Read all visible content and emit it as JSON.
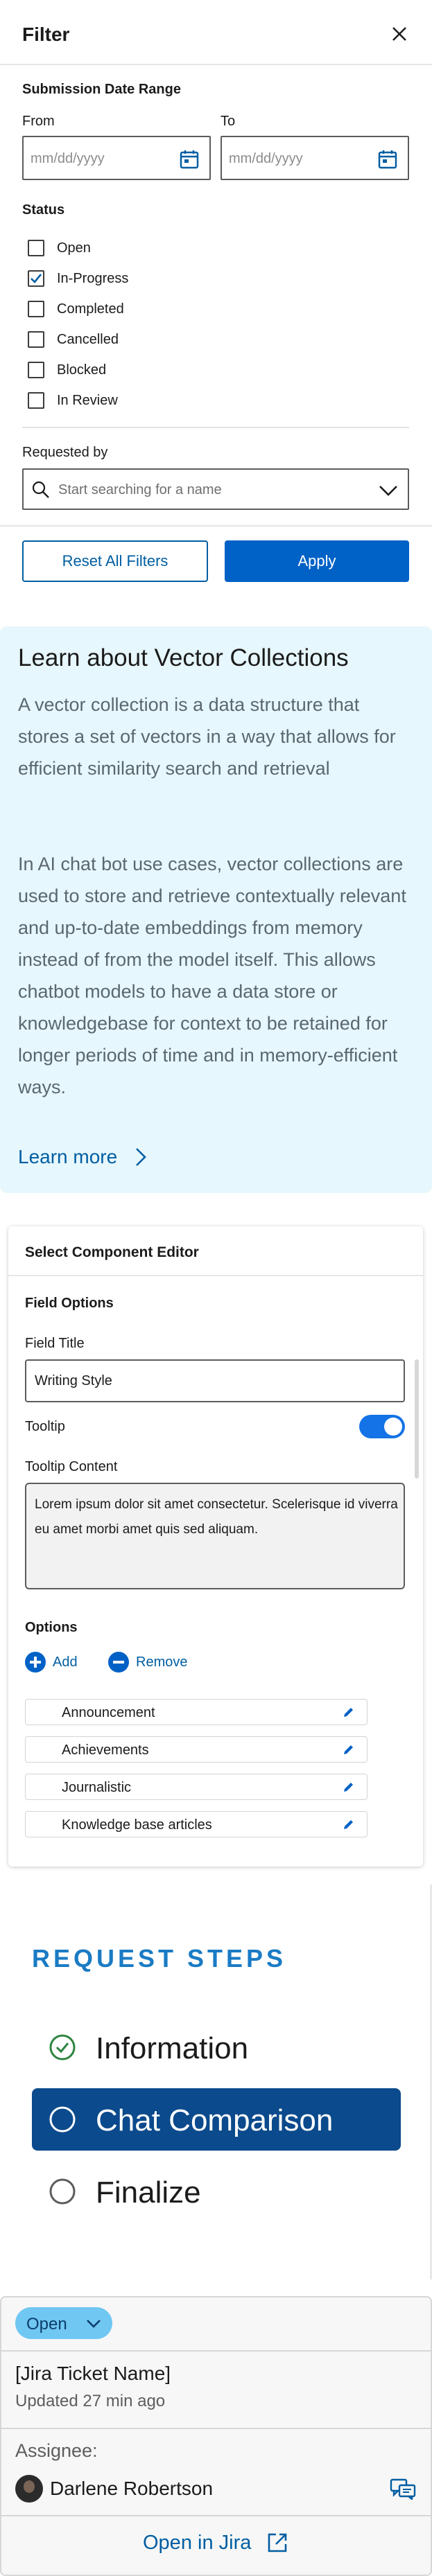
{
  "filter": {
    "title": "Filter",
    "date_range_label": "Submission Date Range",
    "from_label": "From",
    "to_label": "To",
    "from_placeholder": "mm/dd/yyyy",
    "to_placeholder": "mm/dd/yyyy",
    "status_label": "Status",
    "statuses": [
      {
        "label": "Open",
        "checked": false
      },
      {
        "label": "In-Progress",
        "checked": true
      },
      {
        "label": "Completed",
        "checked": false
      },
      {
        "label": "Cancelled",
        "checked": false
      },
      {
        "label": "Blocked",
        "checked": false
      },
      {
        "label": "In Review",
        "checked": false
      }
    ],
    "requested_by_label": "Requested by",
    "requested_by_placeholder": "Start searching for a name",
    "reset_label": "Reset All Filters",
    "apply_label": "Apply"
  },
  "info": {
    "title": "Learn about Vector Collections",
    "paragraph1": "A vector collection is a data structure that stores a set of vectors in a way that allows for efficient similarity search and retrieval",
    "paragraph2": "In AI chat bot use cases, vector collections are used to store and retrieve contextually relevant and up-to-date embeddings from memory instead of from the model itself. This allows chatbot models to have a data store or knowledgebase for context to be retained for longer periods of time and in memory-efficient ways.",
    "learn_more": "Learn more"
  },
  "editor": {
    "header": "Select Component Editor",
    "field_options_label": "Field Options",
    "field_title_label": "Field Title",
    "field_title_value": "Writing Style",
    "tooltip_label": "Tooltip",
    "tooltip_enabled": true,
    "tooltip_content_label": "Tooltip Content",
    "tooltip_content_value": "Lorem ipsum dolor sit amet consectetur. Scelerisque id viverra eu amet morbi amet quis sed aliquam.",
    "options_label": "Options",
    "add_label": "Add",
    "remove_label": "Remove",
    "options": [
      "Announcement",
      "Achievements",
      "Journalistic",
      "Knowledge base articles"
    ]
  },
  "steps": {
    "title": "REQUEST STEPS",
    "items": [
      {
        "label": "Information",
        "state": "complete"
      },
      {
        "label": "Chat Comparison",
        "state": "active"
      },
      {
        "label": "Finalize",
        "state": "pending"
      }
    ]
  },
  "ticket": {
    "status": "Open",
    "name": "[Jira Ticket Name]",
    "updated": "Updated 27 min ago",
    "assignee_label": "Assignee:",
    "assignee_name": "Darlene Robertson",
    "open_label": "Open in Jira"
  },
  "colors": {
    "primary": "#0061c6",
    "link": "#005ea2",
    "info_bg": "#e6f7fd",
    "step_active": "#0b4a8c",
    "status_pill": "#6fc7f2"
  }
}
